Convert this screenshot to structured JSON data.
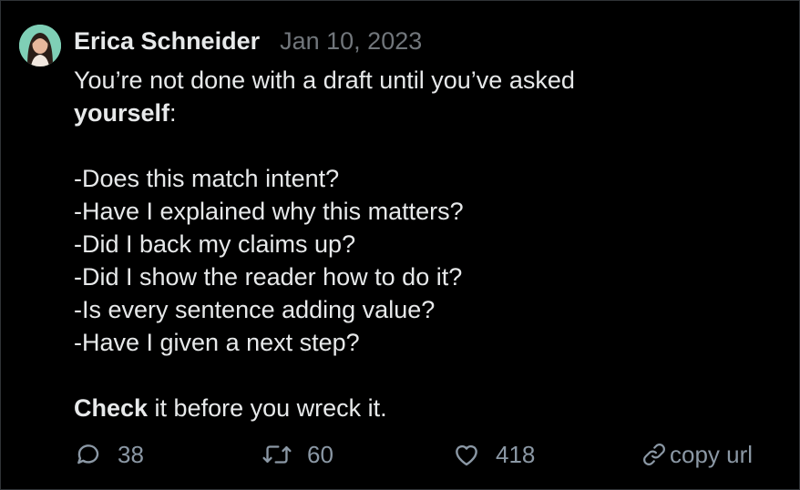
{
  "tweet": {
    "author": "Erica Schneider",
    "date": "Jan 10, 2023",
    "line1": "You’re not done with a draft until you’ve asked",
    "line2_bold": "yourself",
    "line2_rest": ":",
    "questions": [
      "-Does this match intent?",
      "-Have I explained why this matters?",
      "-Did I back my claims up?",
      "-Did I show the reader how to do it?",
      "-Is every sentence adding value?",
      "-Have I given a next step?"
    ],
    "closing_bold": "Check",
    "closing_rest": " it before you wreck it."
  },
  "actions": {
    "reply_count": "38",
    "retweet_count": "60",
    "like_count": "418",
    "copy_label": "copy url"
  },
  "icons": {
    "reply": "speech-bubble-icon",
    "retweet": "retweet-arrows-icon",
    "like": "heart-icon",
    "link": "link-icon"
  },
  "colors": {
    "background": "#000000",
    "text": "#e7e9ea",
    "muted": "#71767b",
    "action": "#8b98a5"
  }
}
